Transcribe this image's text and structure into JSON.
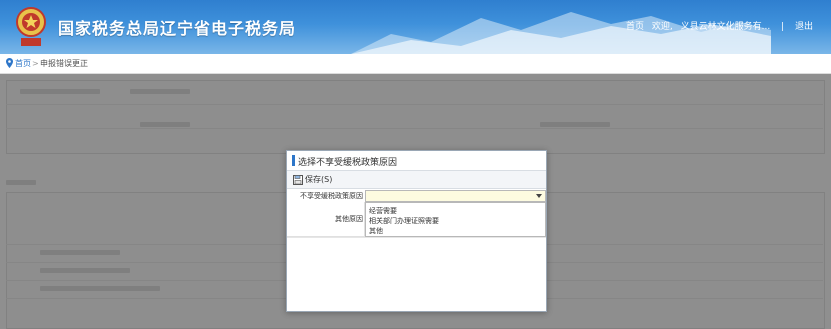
{
  "header": {
    "title": "国家税务总局辽宁省电子税务局",
    "nav": {
      "home": "首页",
      "welcome": "欢迎,",
      "user": "义县云林文化服务有...",
      "divider": "|",
      "logout": "退出"
    }
  },
  "breadcrumb": {
    "home": "首页",
    "separator": ">",
    "current": "申报错误更正"
  },
  "dialog": {
    "title": "选择不享受缓税政策原因",
    "save_label": "保存(S)",
    "reason_label": "不享受缓税政策原因",
    "other_label": "其他原因",
    "options": [
      "经营需要",
      "相关部门办理证照需要",
      "其他"
    ]
  },
  "colors": {
    "header_blue": "#2f7fcf",
    "accent": "#2d76c9",
    "select_bg": "#fdfbe0"
  }
}
